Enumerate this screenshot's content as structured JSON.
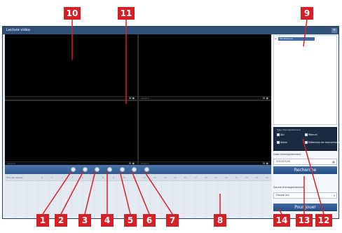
{
  "window": {
    "title": "Lecture vidéo",
    "close_glyph": "✕"
  },
  "video": {
    "cells": [
      {
        "label": "",
        "icons": "⊞ ◉"
      },
      {
        "label": "Canal 2",
        "icons": "⊞ ◉"
      },
      {
        "label": "Canal 3",
        "icons": "⊞ ◉"
      },
      {
        "label": "Canal 4",
        "icons": "⊞ ◉"
      }
    ]
  },
  "timeline": {
    "row_label": "Tous les canaux",
    "hours": [
      "0",
      "2",
      "4",
      "5",
      "6",
      "7",
      "8",
      "9",
      "10",
      "11",
      "12",
      "13",
      "14",
      "15",
      "16",
      "17",
      "18",
      "19",
      "20",
      "21",
      "22",
      "23",
      "24"
    ]
  },
  "right_panel": {
    "tree_item": "Périphérique",
    "tree_expander": "⊟",
    "record_type_title": "Type d'enregistrement",
    "checks": [
      "Ajo",
      "Manuel",
      "Alarm",
      "Détection de mouvement"
    ],
    "date_label": "Date d'enregistrement",
    "date_value": "2015/03/20",
    "date_icon": "▦",
    "search_button": "Recherche",
    "source_label": "Source d'enregistrement",
    "source_value": "Disque dur",
    "source_icon": "▾",
    "play_button": "Pour jouer"
  },
  "callouts": [
    "1",
    "2",
    "3",
    "4",
    "5",
    "6",
    "7",
    "8",
    "9",
    "10",
    "11",
    "12",
    "13",
    "14"
  ],
  "colors": {
    "callout": "#d91f26",
    "accent": "#2f5079",
    "button": "#2f5a8f"
  }
}
